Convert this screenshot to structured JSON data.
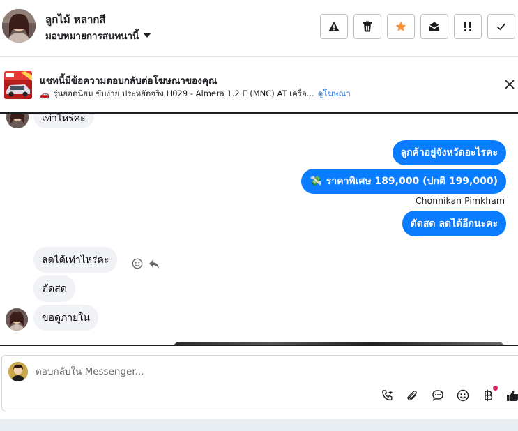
{
  "header": {
    "contact_name": "ลูกไม้ หลากสี",
    "assign_label": "มอบหมายการสนทนานี้",
    "actions": [
      {
        "name": "spam-alert",
        "icon": "warning-triangle-icon"
      },
      {
        "name": "delete",
        "icon": "trash-icon"
      },
      {
        "name": "star",
        "icon": "star-icon",
        "color": "#f7923a"
      },
      {
        "name": "mark-unread",
        "icon": "envelope-open-icon"
      },
      {
        "name": "follow-up",
        "icon": "exclamation-icon"
      },
      {
        "name": "done",
        "icon": "checkmark-icon"
      }
    ]
  },
  "ad": {
    "title": "แชทนี้มีข้อความตอบกลับต่อโฆษณาของคุณ",
    "description": "รุ่นยอดนิยม ขับง่าย ประหยัดจริง H029 - Almera 1.2 E (MNC) AT เครื่อ...",
    "link_label": "ดูโฆษณา",
    "car_emoji": "🚗"
  },
  "chat": {
    "partial_top_message": "เท่าไหร่คะ",
    "outgoing": [
      {
        "text": "ลูกค้าอยู่จังหวัดอะไรคะ"
      },
      {
        "text": "ราคาพิเศษ 189,000 (ปกติ 199,000)",
        "emoji": "💸"
      },
      {
        "text": "ตัดสด ลดได้อีกนะคะ"
      }
    ],
    "sender_name": "Chonnikan Pimkham",
    "incoming": [
      {
        "text": "ลดได้เท่าไหร่คะ"
      },
      {
        "text": "ตัดสด"
      },
      {
        "text": "ขอดูภายใน"
      }
    ]
  },
  "composer": {
    "placeholder": "ตอบกลับใน Messenger...",
    "tools": [
      "call-add-icon",
      "paperclip-icon",
      "saved-reply-icon",
      "emoji-icon",
      "baht-payment-icon",
      "thumbs-up-icon"
    ],
    "accent": "#0a7cff"
  },
  "colors": {
    "outgoing_bubble": "#0a7cff",
    "incoming_bubble": "#f0f2f5",
    "link": "#216fdb"
  }
}
